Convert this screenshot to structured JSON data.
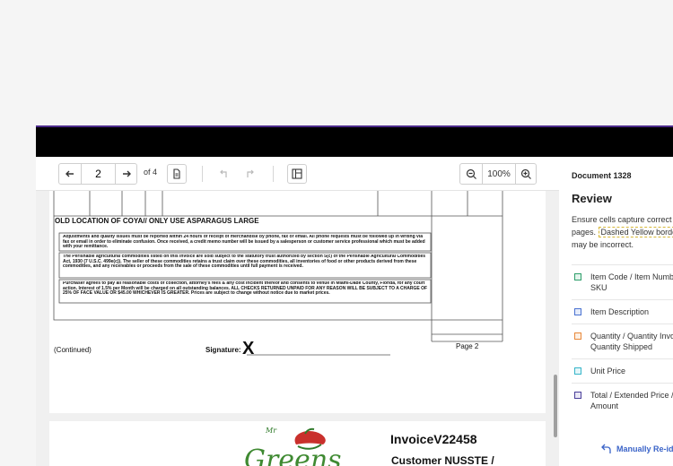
{
  "toolbar": {
    "current_page": "2",
    "page_count": "of 4",
    "zoom": "100%"
  },
  "document_page_1": {
    "section_title": "OLD LOCATION OF COYA// ONLY USE ASPARAGUS LARGE",
    "terms": [
      "Adjustments and quality issues must be reported within 24 hours of receipt of merchandise by phone, fax or email. All phone requests must be followed up in writing via fax or email in order to eliminate confusion. Once received, a credit memo number will be issued by a salesperson or customer service professional which must be added with your remittance.",
      "The Perishable agricultural commodities listed on this invoice are sold subject to the statutory trust authorized by section 5(c) of the Perishable Agricultural Commodities Act, 1930 (7 U.S.C. 499e(c)). The seller of these commodities retains a trust claim over these commodities, all inventories of food or other products derived from these commodities, and any receivables or proceeds from the sale of these commodities until full payment is received.",
      "Purchaser agrees to pay all reasonable costs of collection, attorney's fees & any cost incident thereof and consents to venue in Miami-Dade County, Florida, for any court action. Interest of 1.5% per Month will be charged on all outstanding balances. ALL CHECKS RETURNED UNPAID FOR ANY REASON WILL BE SUBJECT TO A CHARGE OF 25% OF FACE VALUE OR $45.00 WHICHEVER IS GREATER. Prices are subject to change without notice due to market prices."
    ],
    "continued": "(Continued)",
    "signature_label": "Signature:",
    "signature_mark": "X",
    "page_label": "Page 2"
  },
  "document_page_2": {
    "logo_small": "Mr",
    "logo_text": "Greens",
    "invoice_title": "InvoiceV22458",
    "customer": "Customer NUSSTE /"
  },
  "review_panel": {
    "document_name": "Document 1328",
    "title": "Review",
    "line1": "Ensure cells capture correct l",
    "line2_prefix": "pages.",
    "line2_highlight": "Dashed Yellow borde",
    "line3": "may be incorrect.",
    "legend": [
      {
        "label": "Item Code / Item Number / SKU",
        "color": "#2e9e6a"
      },
      {
        "label": "Item Description",
        "color": "#4a72d1"
      },
      {
        "label": "Quantity / Quantity Invoice / Quantity Shipped",
        "color": "#e8883a"
      },
      {
        "label": "Unit Price",
        "color": "#36b5c9"
      },
      {
        "label": "Total / Extended Price / Amount",
        "color": "#4a3f9a"
      }
    ],
    "reid_label": "Manually Re-id"
  }
}
